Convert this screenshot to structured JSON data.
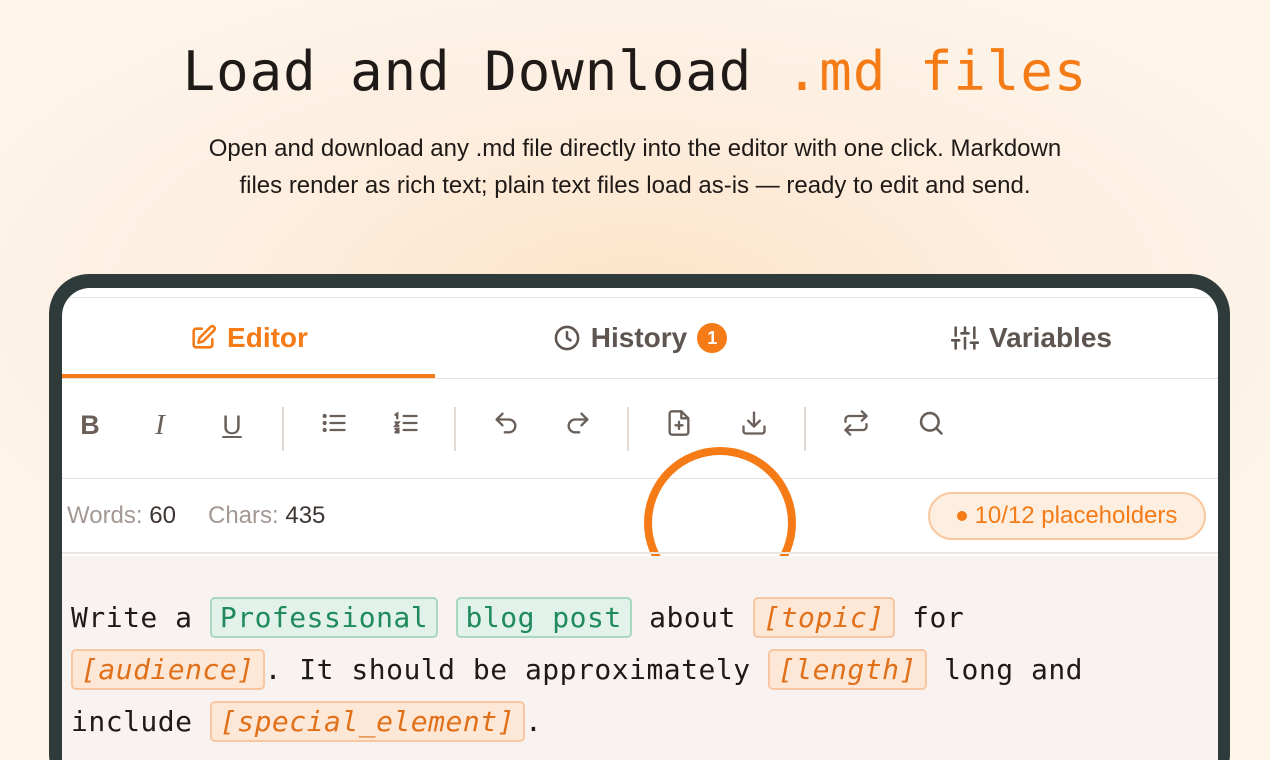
{
  "hero": {
    "title_main": "Load and Download ",
    "title_accent": ".md files",
    "subtitle_line1": "Open and download any .md file directly into the editor with one click. Markdown",
    "subtitle_line2": "files render as rich text; plain text files load as-is — ready to edit and send."
  },
  "tabs": [
    {
      "label": "Editor",
      "icon": "edit-icon",
      "active": true
    },
    {
      "label": "History",
      "icon": "clock-icon",
      "badge": "1"
    },
    {
      "label": "Variables",
      "icon": "sliders-icon"
    }
  ],
  "toolbar": {
    "bold": "B",
    "italic": "I",
    "underline": "U",
    "icons": [
      "bullet-list-icon",
      "numbered-list-icon",
      "undo-icon",
      "redo-icon",
      "load-file-icon",
      "download-icon",
      "swap-icon",
      "search-icon"
    ]
  },
  "stats": {
    "words_label": "Words:",
    "words_value": "60",
    "chars_label": "Chars:",
    "chars_value": "435",
    "placeholders": "10/12 placeholders"
  },
  "editor": {
    "t1": "Write a ",
    "v1": "Professional",
    "v2": "blog post",
    "t2": " about ",
    "p1": "[topic]",
    "t3": " for",
    "p2": "[audience]",
    "t4": ". It should be approximately ",
    "p3": "[length]",
    "t5": " long and",
    "t6": "include ",
    "p4": "[special_element]",
    "t7": "."
  },
  "colors": {
    "accent": "#f47b16",
    "frame": "#2f3a3b",
    "variable_green": "#1f8b5c",
    "placeholder_orange": "#e0701a"
  }
}
